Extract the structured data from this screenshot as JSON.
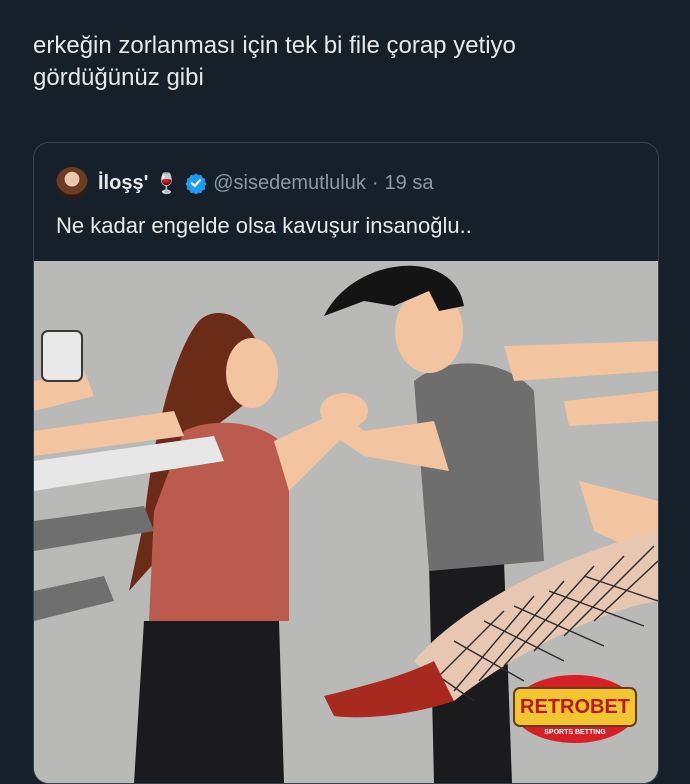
{
  "post": {
    "text": "erkeğin zorlanması için tek bi file çorap yetiyo\ngördüğünüz gibi"
  },
  "quote": {
    "display_name": "İloşş'",
    "emoji": "🍷",
    "verified_icon": "verified-badge-icon",
    "handle": "@sisedemutluluk",
    "separator": "·",
    "time": "19 sa",
    "text": "Ne kadar engelde olsa kavuşur insanoğlu.."
  },
  "illustration": {
    "logo_text": "RETROBET",
    "logo_subtext": "SPORTS BETTING"
  },
  "colors": {
    "background": "#15202b",
    "border": "#38444d",
    "secondary_text": "#8b98a5",
    "verified": "#1d9bf0"
  }
}
